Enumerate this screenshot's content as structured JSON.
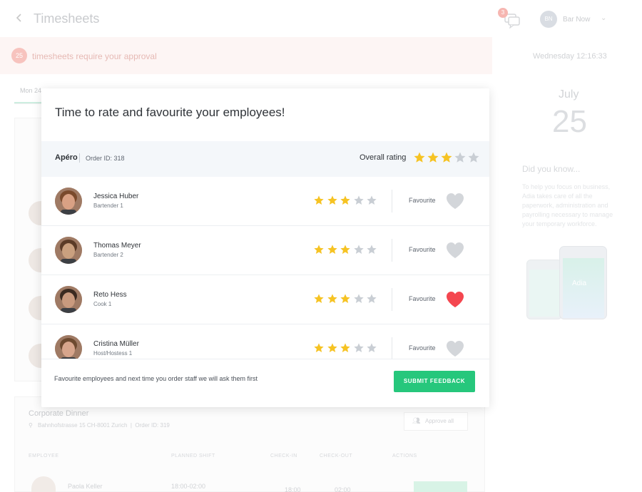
{
  "app": {
    "title": "Timesheets",
    "back_icon": "chevron-left-icon",
    "notifications_count": "3",
    "user_initials": "BN",
    "user_name": "Bar Now"
  },
  "approval": {
    "count": "25",
    "text": "timesheets require your approval"
  },
  "tabs": {
    "first_label": "Mon 24"
  },
  "background_order": {
    "title": "Corporate Dinner",
    "address": "Bahnhofstrasse 15 CH-8001 Zurich",
    "order_id": "Order ID: 319",
    "approve_all": "Approve all",
    "columns": [
      "EMPLOYEE",
      "PLANNED SHIFT",
      "CHECK-IN",
      "CHECK-OUT",
      "ACTIONS"
    ],
    "row": {
      "name": "Paola Keller",
      "shift": "18:00-02:00",
      "check_in": "18:00",
      "check_out": "02:00"
    }
  },
  "sidebar": {
    "date_line": "Wednesday 12:16:33",
    "month": "July",
    "day": "25",
    "did_you_know_title": "Did you know...",
    "did_you_know_text": "To help you focus on business, Adia takes care of all the paperwork, administration and payrolling necessary to manage your temporary workforce.",
    "phone_logo": "Adia"
  },
  "modal": {
    "title": "Time to rate and favourite your employees!",
    "order": {
      "name": "Apéro",
      "id": "Order ID: 318",
      "overall_label": "Overall rating",
      "overall_rating": 3,
      "max_rating": 5
    },
    "employees": [
      {
        "name": "Jessica Huber",
        "role": "Bartender 1",
        "rating": 3,
        "favourite": false,
        "fav_label": "Favourite"
      },
      {
        "name": "Thomas Meyer",
        "role": "Bartender 2",
        "rating": 3,
        "favourite": false,
        "fav_label": "Favourite"
      },
      {
        "name": "Reto Hess",
        "role": "Cook 1",
        "rating": 3,
        "favourite": true,
        "fav_label": "Favourite"
      },
      {
        "name": "Cristina Müller",
        "role": "Host/Hostess 1",
        "rating": 3,
        "favourite": false,
        "fav_label": "Favourite"
      }
    ],
    "footer_note": "Favourite employees and next time you order staff we will ask them first",
    "submit_label": "SUBMIT FEEDBACK"
  },
  "colors": {
    "star_filled": "#f6c323",
    "star_empty": "#c9ced4",
    "heart_favourite": "#f4464f",
    "heart_default": "#d3d6da",
    "primary_button": "#26c77c"
  }
}
